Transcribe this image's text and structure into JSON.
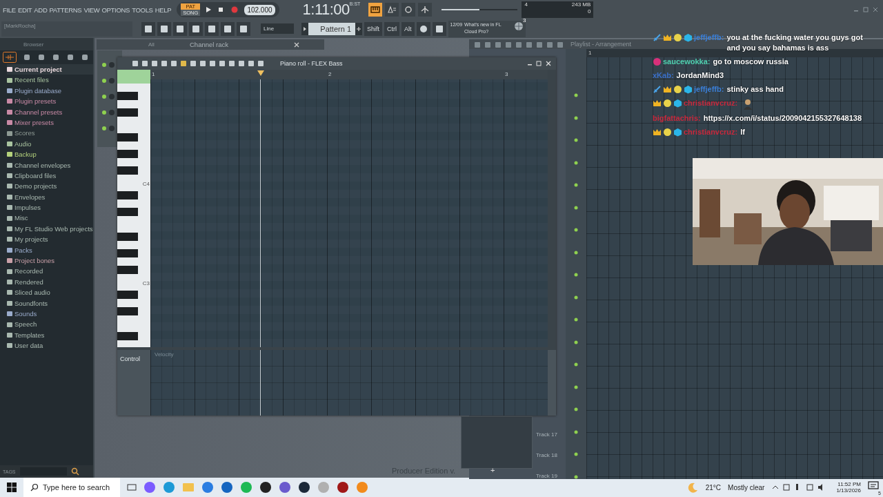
{
  "menu": [
    "FILE",
    "EDIT",
    "ADD",
    "PATTERNS",
    "VIEW",
    "OPTIONS",
    "TOOLS",
    "HELP"
  ],
  "transport": {
    "modes": [
      {
        "label": "PAT",
        "selected": true
      },
      {
        "label": "SONG",
        "selected": false
      }
    ],
    "tempo": "102.000",
    "time": "1:11:00",
    "time_unit": "B:ST"
  },
  "cpu": {
    "cores": "4",
    "memory": "243 MB",
    "polyphony": "0"
  },
  "master_pitch": {
    "level": 0.5
  },
  "hint_bar": "[MarkRocha]",
  "snap": "Line",
  "pattern": "Pattern 1",
  "modifier_keys": [
    "Shift",
    "Ctrl",
    "Alt"
  ],
  "news": {
    "date": "12/09",
    "text": "What's new in FL Cloud Pro?",
    "count": "3"
  },
  "browser": {
    "title": "Browser",
    "items": [
      {
        "label": "Current project",
        "color": "#e8d8dc",
        "selected": true
      },
      {
        "label": "Recent files",
        "color": "#a9c4a0",
        "selected": false
      },
      {
        "label": "Plugin database",
        "color": "#9aaccc",
        "selected": false
      },
      {
        "label": "Plugin presets",
        "color": "#c98aa6",
        "selected": false
      },
      {
        "label": "Channel presets",
        "color": "#c98aa6",
        "selected": false
      },
      {
        "label": "Mixer presets",
        "color": "#c98aa6",
        "selected": false
      },
      {
        "label": "Scores",
        "color": "#8e9a94",
        "selected": false
      },
      {
        "label": "Audio",
        "color": "#a9c4a0",
        "selected": false
      },
      {
        "label": "Backup",
        "color": "#b4d27c",
        "selected": false
      },
      {
        "label": "Channel envelopes",
        "color": "#a9b9b0",
        "selected": false
      },
      {
        "label": "Clipboard files",
        "color": "#a9b9b0",
        "selected": false
      },
      {
        "label": "Demo projects",
        "color": "#a9b9b0",
        "selected": false
      },
      {
        "label": "Envelopes",
        "color": "#a9b9b0",
        "selected": false
      },
      {
        "label": "Impulses",
        "color": "#a9b9b0",
        "selected": false
      },
      {
        "label": "Misc",
        "color": "#a9b9b0",
        "selected": false
      },
      {
        "label": "My FL Studio Web projects",
        "color": "#a9b9b0",
        "selected": false
      },
      {
        "label": "My projects",
        "color": "#a9b9b0",
        "selected": false
      },
      {
        "label": "Packs",
        "color": "#9aaccc",
        "selected": false
      },
      {
        "label": "Project bones",
        "color": "#c9a0a8",
        "selected": false
      },
      {
        "label": "Recorded",
        "color": "#a9b9b0",
        "selected": false
      },
      {
        "label": "Rendered",
        "color": "#a9b9b0",
        "selected": false
      },
      {
        "label": "Sliced audio",
        "color": "#a9b9b0",
        "selected": false
      },
      {
        "label": "Soundfonts",
        "color": "#a9b9b0",
        "selected": false
      },
      {
        "label": "Sounds",
        "color": "#9aaccc",
        "selected": false
      },
      {
        "label": "Speech",
        "color": "#a9b9b0",
        "selected": false
      },
      {
        "label": "Templates",
        "color": "#a9b9b0",
        "selected": false
      },
      {
        "label": "User data",
        "color": "#a9b9b0",
        "selected": false
      }
    ],
    "tags": "TAGS"
  },
  "channel_rack": {
    "filter": "All",
    "title": "Channel rack"
  },
  "piano_roll": {
    "title": "Piano roll - FLEX Bass",
    "bars": [
      "1",
      "2",
      "3"
    ],
    "key_labels": [
      "C4",
      "C3"
    ],
    "control": "Control",
    "control_target": "Velocity"
  },
  "playlist": {
    "title": "Playlist - Arrangement",
    "bar": "1",
    "tracks": [
      "Track 17",
      "Track 18",
      "Track 19"
    ],
    "add": "+"
  },
  "producer_edition": "Producer Edition v.",
  "chat": [
    {
      "user": "jeffjeffb:",
      "color": "#3a7fd8",
      "badges": [
        {
          "kind": "sword"
        },
        {
          "kind": "crown"
        },
        {
          "kind": "coin"
        },
        {
          "kind": "cube"
        }
      ],
      "text": "you at the fucking water you guys got and you say bahamas is ass"
    },
    {
      "user": "saucewokka:",
      "color": "#4fd1b0",
      "badges": [
        {
          "kind": "orb"
        }
      ],
      "text": "go to moscow russia"
    },
    {
      "user": "xKab:",
      "color": "#3a6fc8",
      "text": "JordanMind3"
    },
    {
      "user": "jeffjeffb:",
      "color": "#3a7fd8",
      "badges": [
        {
          "kind": "sword"
        },
        {
          "kind": "crown"
        },
        {
          "kind": "coin"
        },
        {
          "kind": "cube"
        }
      ],
      "text": "stinky ass hand"
    },
    {
      "user": "christianvcruz:",
      "color": "#c8283c",
      "badges": [
        {
          "kind": "crown"
        },
        {
          "kind": "coin"
        },
        {
          "kind": "cube"
        }
      ],
      "emote": true
    },
    {
      "user": "bigfattachris:",
      "color": "#c8283c",
      "text": "https://x.com/i/status/2009042155327648138"
    },
    {
      "user": "christianvcruz:",
      "color": "#c8283c",
      "badges": [
        {
          "kind": "crown"
        },
        {
          "kind": "coin"
        },
        {
          "kind": "cube"
        }
      ],
      "text": "lf"
    }
  ],
  "taskbar": {
    "search": {
      "placeholder": "Type here to search"
    },
    "temperature": "21°C",
    "weather": "Mostly clear",
    "time": "11:52 PM",
    "date": "1/13/2026",
    "notifications": "5"
  }
}
